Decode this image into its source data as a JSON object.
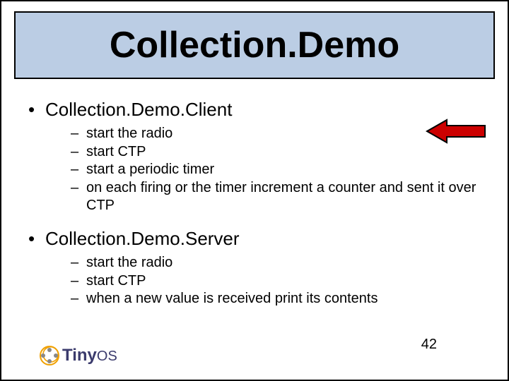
{
  "title": "Collection.Demo",
  "sections": [
    {
      "heading": "Collection.Demo.Client",
      "items": [
        "start the radio",
        "start CTP",
        "start a periodic timer",
        "on each firing or the timer increment a counter and sent it over CTP"
      ]
    },
    {
      "heading": "Collection.Demo.Server",
      "items": [
        "start the radio",
        "start CTP",
        "when a new value is received print its contents"
      ]
    }
  ],
  "logo": {
    "prefix": "Tiny",
    "suffix": "OS"
  },
  "page_number": "42",
  "arrow_color": "#cc0000",
  "arrow_outline": "#000000"
}
